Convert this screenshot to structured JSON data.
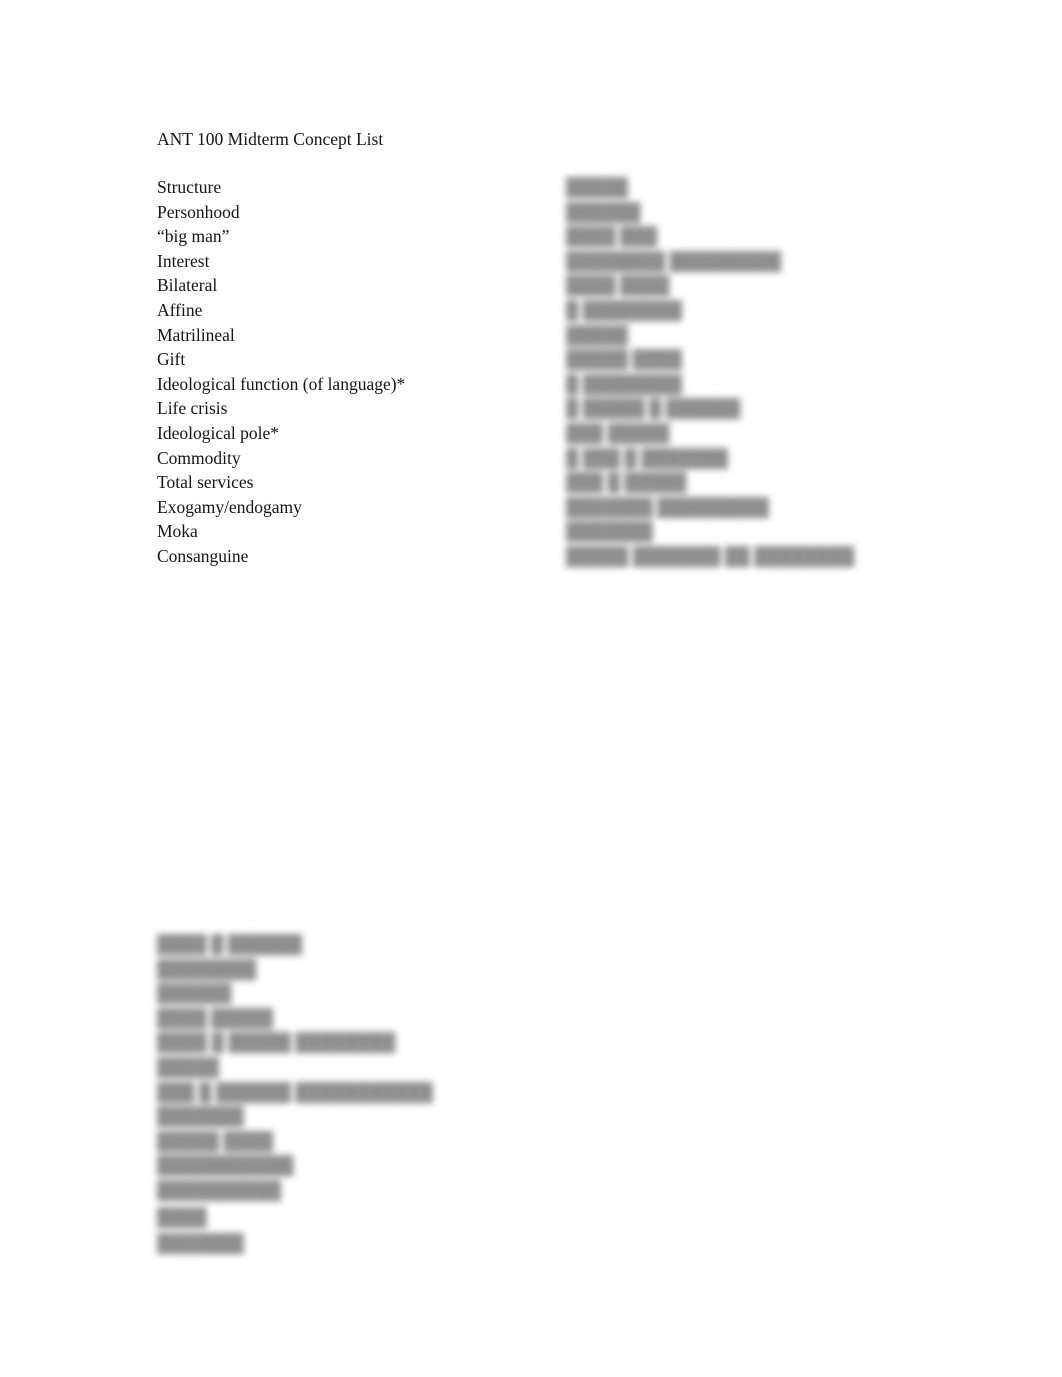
{
  "document": {
    "title": "ANT 100 Midterm Concept List",
    "page_background": "#ffffff",
    "text_color": "#151515",
    "blurred_text_color": "#4a4a4a"
  },
  "concept_list": {
    "items": [
      "Structure",
      "Personhood",
      "“big man”",
      "Interest",
      "Bilateral",
      "Affine",
      "Matrilineal",
      "Gift",
      "Ideological function (of language)*",
      "Life crisis",
      "Ideological pole*",
      "Commodity",
      "Total services",
      "Exogamy/endogamy",
      "Moka",
      "Consanguine"
    ]
  },
  "redacted_right_column": {
    "note": "blurred, illegible",
    "lines": [
      "█████",
      "██████",
      "████ ███",
      "████████ █████████",
      "████ ████",
      "█ ████████",
      "█████",
      "█████ ████",
      "█ ████████",
      "█ █████ █ ██████",
      "███ █████",
      "█ ███   █ ███████",
      "███ █ █████",
      "███████ █████████",
      "███████",
      "█████ ███████ ██ ████████"
    ]
  },
  "redacted_bottom_block": {
    "note": "blurred, illegible",
    "lines": [
      "████ █ ██████",
      "████████",
      "██████",
      "████ █████",
      "████  █ █████ ████████",
      "█████",
      "███  █  ██████ ███████████",
      "███████",
      "█████ ████",
      "███████████",
      "██████████",
      "████",
      "███████"
    ]
  }
}
